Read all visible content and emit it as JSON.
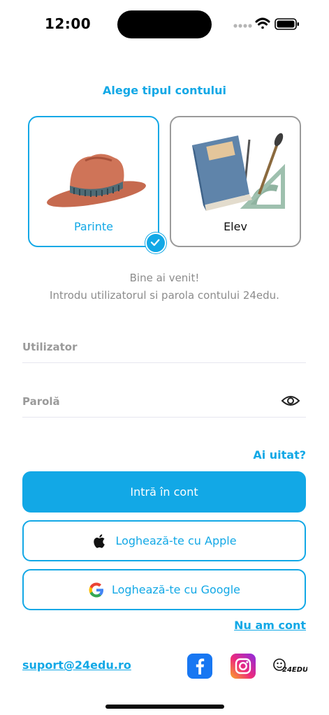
{
  "status_bar": {
    "time": "12:00"
  },
  "account_type": {
    "title": "Alege tipul contului",
    "options": [
      {
        "label": "Parinte",
        "selected": true
      },
      {
        "label": "Elev",
        "selected": false
      }
    ]
  },
  "welcome": {
    "line1": "Bine ai venit!",
    "line2": "Introdu utilizatorul si parola contului 24edu."
  },
  "form": {
    "username_placeholder": "Utilizator",
    "password_placeholder": "Parolă",
    "forgot_label": "Ai uitat?"
  },
  "buttons": {
    "login": "Intră în cont",
    "apple": "Loghează-te cu Apple",
    "google": "Loghează-te cu Google"
  },
  "links": {
    "no_account": "Nu am cont",
    "support_email": "suport@24edu.ro"
  },
  "footer": {
    "logo_text": "24EDU"
  },
  "colors": {
    "accent": "#12a8e6",
    "muted": "#8c8c8c",
    "facebook": "#1877f2"
  },
  "icons": [
    "wifi-icon",
    "battery-icon",
    "signal-icon",
    "eye-icon",
    "check-icon",
    "apple-icon",
    "google-icon",
    "facebook-icon",
    "instagram-icon"
  ]
}
